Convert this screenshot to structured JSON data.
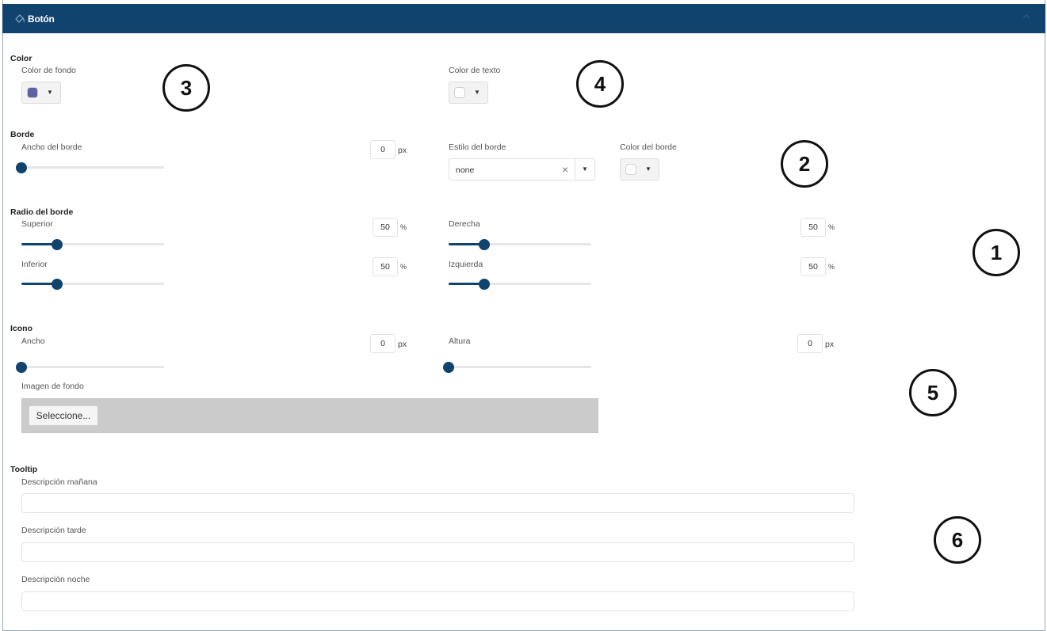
{
  "header": {
    "title": "Botón",
    "icon": "paint-icon",
    "collapse_icon": "chevron-up-icon"
  },
  "color": {
    "section_title": "Color",
    "background": {
      "label": "Color de fondo",
      "swatch": "#5b63a5"
    },
    "text": {
      "label": "Color de texto",
      "swatch": "#ffffff"
    }
  },
  "border": {
    "section_title": "Borde",
    "width": {
      "label": "Ancho del borde",
      "value": "0",
      "unit": "px",
      "level": 0
    },
    "style": {
      "label": "Estilo del borde",
      "value": "none"
    },
    "color": {
      "label": "Color del borde",
      "swatch": "#ffffff"
    }
  },
  "radius": {
    "section_title": "Radio del borde",
    "top": {
      "label": "Superior",
      "value": "50",
      "unit": "%",
      "level": 0.25
    },
    "right": {
      "label": "Derecha",
      "value": "50",
      "unit": "%",
      "level": 0.25
    },
    "bottom": {
      "label": "Inferior",
      "value": "50",
      "unit": "%",
      "level": 0.25
    },
    "left": {
      "label": "Izquierda",
      "value": "50",
      "unit": "%",
      "level": 0.25
    }
  },
  "icon": {
    "section_title": "Icono",
    "width": {
      "label": "Ancho",
      "value": "0",
      "unit": "px",
      "level": 0
    },
    "height": {
      "label": "Altura",
      "value": "0",
      "unit": "px",
      "level": 0
    },
    "background_image": {
      "label": "Imagen de fondo",
      "button_label": "Seleccione..."
    }
  },
  "tooltip": {
    "section_title": "Tooltip",
    "morning": {
      "label": "Descripción mañana",
      "value": ""
    },
    "afternoon": {
      "label": "Descripción tarde",
      "value": ""
    },
    "night": {
      "label": "Descripción noche",
      "value": ""
    }
  },
  "callouts": [
    "1",
    "2",
    "3",
    "4",
    "5",
    "6"
  ],
  "colors": {
    "accent": "#10446e",
    "track": "#e6e6e6"
  }
}
